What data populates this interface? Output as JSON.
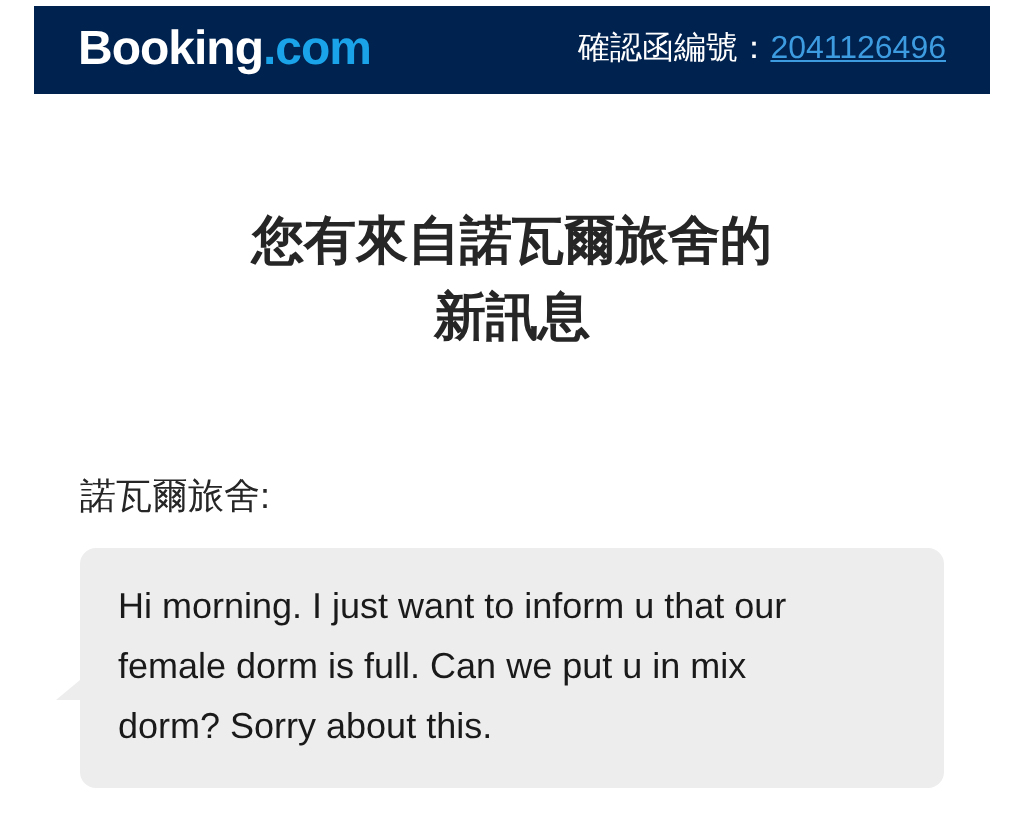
{
  "header": {
    "logo": {
      "name": "Booking",
      "suffix": ".com"
    },
    "confirmation_label": "確認函編號：",
    "confirmation_number": "2041126496"
  },
  "title": "您有來自諾瓦爾旅舍的新訊息",
  "message": {
    "sender": "諾瓦爾旅舍:",
    "text": "Hi morning. I just want to inform u that our female dorm is full. Can we put u in mix dorm? Sorry about this."
  }
}
